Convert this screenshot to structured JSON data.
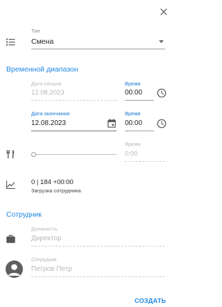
{
  "type_field": {
    "label": "Тип",
    "value": "Смена"
  },
  "time_range": {
    "header": "Временной диапазон",
    "start": {
      "date_label": "Дата начала",
      "date_value": "12.08.2023",
      "time_label": "Время",
      "time_value": "00:00"
    },
    "end": {
      "date_label": "Дата окончания",
      "date_value": "12.08.2023",
      "time_label": "Время",
      "time_value": "00:00"
    },
    "break": {
      "time_label": "Время",
      "time_value": "0:00"
    }
  },
  "workload": {
    "value": "0 | 184 +00:00",
    "caption": "Загрузка сотрудника"
  },
  "employee": {
    "header": "Сотрудник",
    "position": {
      "label": "Должность",
      "value": "Директор"
    },
    "person": {
      "label": "Сотрудник",
      "value": "Петров Петр"
    }
  },
  "actions": {
    "create_label": "СОЗДАТЬ"
  }
}
